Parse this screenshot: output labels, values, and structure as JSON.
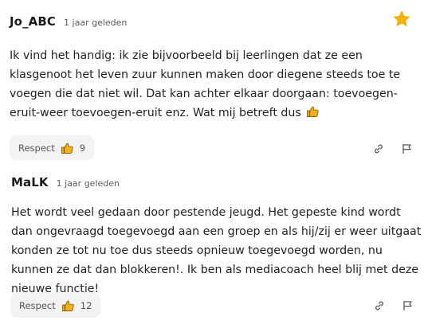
{
  "comments": [
    {
      "username": "Jo_ABC",
      "time": "1 jaar geleden",
      "text": "Ik vind het handig: ik zie bijvoorbeeld bij leerlingen dat ze een klasgenoot het leven zuur kunnen maken door diegene steeds toe te voegen die dat niet wil. Dat kan achter elkaar doorgaan: toevoegen-eruit-weer toevoegen-eruit enz. Wat mij betreft dus",
      "respect_label": "Respect",
      "respect_count": "9",
      "starred": true
    },
    {
      "username": "MaLK",
      "time": "1 jaar geleden",
      "text": "Het wordt veel gedaan door pestende jeugd. Het gepeste kind wordt dan ongevraagd toegevoegd aan een groep en als hij/zij er weer uitgaat konden ze tot nu toe dus steeds opnieuw toegevoegd worden, nu kunnen ze dat dan blokkeren!. Ik ben als mediacoach heel blij met deze nieuwe functie!",
      "respect_label": "Respect",
      "respect_count": "12",
      "starred": false
    }
  ],
  "icons": {
    "star": "star-icon",
    "thumb": "thumbs-up-icon",
    "link": "link-icon",
    "flag": "flag-icon"
  },
  "colors": {
    "star": "#f5b301",
    "thumb": "#f2b01e",
    "button_bg": "#f3f3f3"
  }
}
